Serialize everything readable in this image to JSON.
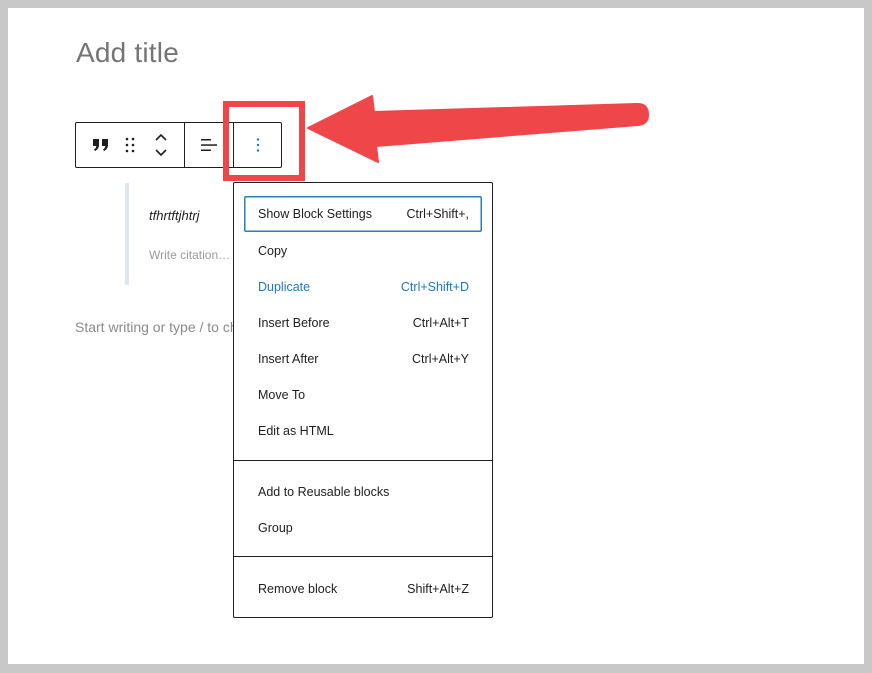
{
  "editor": {
    "title_placeholder": "Add title",
    "paragraph_placeholder": "Start writing or type / to choose a block"
  },
  "toolbar": {
    "buttons": [
      {
        "name": "quote-block-type",
        "icon": "quote-icon"
      },
      {
        "name": "drag-handle",
        "icon": "drag-handle-icon"
      },
      {
        "name": "move-up-down",
        "icon": "chevron-up-down-icon"
      },
      {
        "name": "align",
        "icon": "align-left-icon"
      },
      {
        "name": "more-options",
        "icon": "more-vertical-icon",
        "active": true
      }
    ]
  },
  "quote": {
    "text": "tfhrtftjhtrj",
    "citation_placeholder": "Write citation…"
  },
  "menu": {
    "groups": [
      [
        {
          "label": "Show Block Settings",
          "shortcut": "Ctrl+Shift+,",
          "focused": true
        },
        {
          "label": "Copy",
          "shortcut": ""
        },
        {
          "label": "Duplicate",
          "shortcut": "Ctrl+Shift+D",
          "accent": true
        },
        {
          "label": "Insert Before",
          "shortcut": "Ctrl+Alt+T"
        },
        {
          "label": "Insert After",
          "shortcut": "Ctrl+Alt+Y"
        },
        {
          "label": "Move To",
          "shortcut": ""
        },
        {
          "label": "Edit as HTML",
          "shortcut": ""
        }
      ],
      [
        {
          "label": "Add to Reusable blocks",
          "shortcut": ""
        },
        {
          "label": "Group",
          "shortcut": ""
        }
      ],
      [
        {
          "label": "Remove block",
          "shortcut": "Shift+Alt+Z"
        }
      ]
    ]
  },
  "annotation": {
    "color": "#ef4649",
    "kind": "arrow-pointing-left"
  },
  "colors": {
    "accent": "#1a78be",
    "focus_ring": "#2e7cb8",
    "text": "#1e1e1e",
    "placeholder": "#757575",
    "quote_border": "#dde6ee"
  }
}
